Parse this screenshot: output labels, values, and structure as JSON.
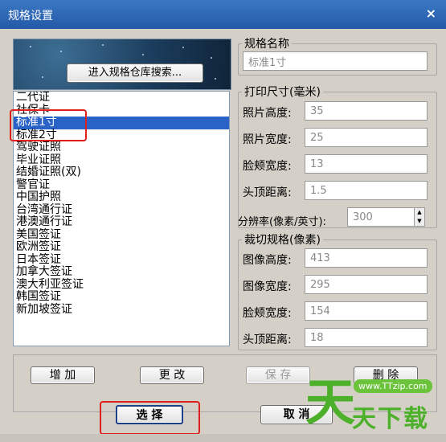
{
  "window": {
    "title": "规格设置",
    "close": "×"
  },
  "search_button": "进入规格仓库搜索...",
  "spec_list": {
    "items": [
      "二代证",
      "社保卡",
      "标准1寸",
      "标准2寸",
      "驾驶证照",
      "毕业证照",
      "结婚证照(双)",
      "警官证",
      "中国护照",
      "台湾通行证",
      "港澳通行证",
      "美国签证",
      "欧洲签证",
      "日本签证",
      "加拿大签证",
      "澳大利亚签证",
      "韩国签证",
      "新加坡签证"
    ],
    "selected_index": 2
  },
  "spec_name": {
    "legend": "规格名称",
    "value": "标准1寸"
  },
  "print_size": {
    "legend": "打印尺寸(毫米)",
    "rows": [
      {
        "label": "照片高度:",
        "value": "35"
      },
      {
        "label": "照片宽度:",
        "value": "25"
      },
      {
        "label": "脸颊宽度:",
        "value": "13"
      },
      {
        "label": "头顶距离:",
        "value": "1.5"
      }
    ]
  },
  "resolution": {
    "label": "分辨率(像素/英寸):",
    "value": "300"
  },
  "crop": {
    "legend": "裁切规格(像素)",
    "rows": [
      {
        "label": "图像高度:",
        "value": "413"
      },
      {
        "label": "图像宽度:",
        "value": "295"
      },
      {
        "label": "脸颊宽度:",
        "value": "154"
      },
      {
        "label": "头顶距离:",
        "value": "18"
      }
    ]
  },
  "buttons": {
    "add": "增 加",
    "edit": "更 改",
    "save": "保 存",
    "delete": "删 除",
    "select": "选 择",
    "cancel": "取 消"
  },
  "watermark": {
    "url": "www.TTzip.com",
    "char": "天",
    "text": "天下载"
  },
  "colors": {
    "selection": "#2a63c7",
    "highlight": "#e0201c",
    "watermark": "#4db02a"
  }
}
